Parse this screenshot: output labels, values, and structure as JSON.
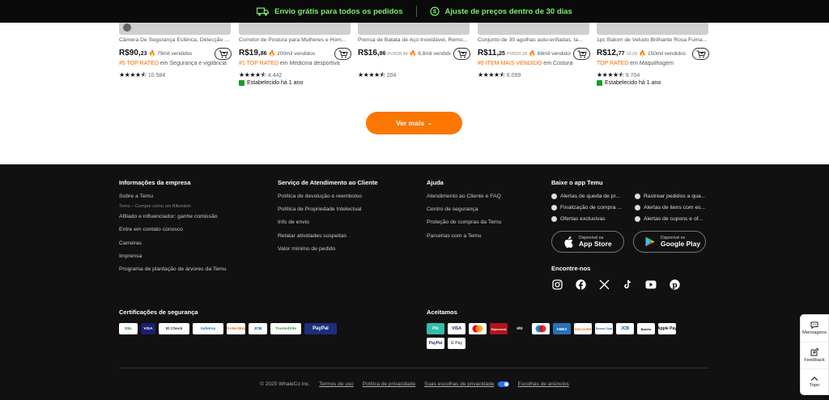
{
  "topbar": {
    "shipping": "Envio grátis para todos os pedidos",
    "price_adjust": "Ajuste de preços dentro de 30 dias"
  },
  "products": [
    {
      "title": "Câmera De Segurança Esférica, Detecção D...",
      "price_int": "R$90,",
      "price_dec": "23",
      "rrp": "",
      "sold": "79mil vendidos",
      "rank_hl": "#5 TOP RATED",
      "rank_rest": " em Segurança e vigilância",
      "rating_count": "10.584",
      "established": ""
    },
    {
      "title": "Corretor de Postura para Mulheres e Hom...",
      "price_int": "R$19,",
      "price_dec": "86",
      "rrp": "",
      "sold": "200mil vendidos",
      "rank_hl": "#1 TOP RATED",
      "rank_rest": " em Medicina desportiva",
      "rating_count": "4.442",
      "established": "Estabelecido há 1 ano"
    },
    {
      "title": "Prensa de Batata de Aço Inoxidável, Remo...",
      "price_int": "R$16,",
      "price_dec": "86",
      "rrp": "PVR28,44",
      "sold": "6,8mil vendidos",
      "rank_hl": "",
      "rank_rest": "",
      "rating_count": "204",
      "established": ""
    },
    {
      "title": "Conjunto de 30 agulhas auto-enfiadas, ta...",
      "price_int": "R$11,",
      "price_dec": "25",
      "rrp": "PVR20,18",
      "sold": "68mil vendidos",
      "rank_hl": "#6 ITEM MAIS VENDIDO",
      "rank_rest": " em Costura",
      "rating_count": "6.099",
      "established": ""
    },
    {
      "title": "1pc Batom de Veludo Brilhante Rosa Fuma...",
      "price_int": "R$12,",
      "price_dec": "77",
      "rrp": "19,99",
      "sold": "150mil vendidos",
      "rank_hl": "TOP RATED",
      "rank_rest": " em Maquilhagem",
      "rating_count": "9.704",
      "established": "Estabelecido há 1 ano"
    }
  ],
  "ver_mais": "Ver mais",
  "footer": {
    "company": {
      "heading": "Informações da empresa",
      "about": "Sobre a Temu",
      "tagline": "Temu – Compre como um Bilionário",
      "affiliate": "Afiliado e influenciador: ganhe comissão",
      "contact": "Entre em contato conosco",
      "careers": "Carreiras",
      "press": "Imprensa",
      "trees": "Programa de plantação de árvores da Temu"
    },
    "service": {
      "heading": "Serviço de Atendimento ao Cliente",
      "items": [
        "Política de devolução e reembolso",
        "Política de Propriedade Intelectual",
        "Info de envio",
        "Relatar atividades suspeitas",
        "Valor mínimo de pedido"
      ]
    },
    "help": {
      "heading": "Ajuda",
      "items": [
        "Atendimento ao Cliente e FAQ",
        "Centro de segurança",
        "Proteção de compras da Temu",
        "Parcerias com a Temu"
      ]
    },
    "app": {
      "heading": "Baixe o app Temu",
      "features": [
        "Alertas de queda de pr...",
        "Rastrear pedidos a qua...",
        "Finalização de compra ...",
        "Alertas de itens com es...",
        "Ofertas exclusivas",
        "Alertas de cupons e of..."
      ],
      "appstore_small": "Disponível na",
      "appstore": "App Store",
      "googleplay_small": "Disponível no",
      "googleplay": "Google Play"
    },
    "social_heading": "Encontre-nos",
    "security_heading": "Certificações de segurança",
    "security_badges": [
      "SSL",
      "VISA",
      "ID Check",
      "SafeKey",
      "ProtectBuy",
      "JCB",
      "TrustedSite",
      "PayPal"
    ],
    "accept_heading": "Aceitamos",
    "payments": [
      "Pix",
      "VISA",
      "Mastercard",
      "Hipercard",
      "elo",
      "Maestro",
      "AMEX",
      "DISCOVER",
      "Diners Club",
      "JCB",
      "Boleto",
      "Apple Pay",
      "PayPal",
      "G Pay"
    ],
    "legal": {
      "copyright": "© 2025 WhaleCo Inc.",
      "terms": "Termos de uso",
      "privacy": "Política de privacidade",
      "choices": "Suas escolhas de privacidade",
      "ads": "Escolhas de anúncios"
    }
  },
  "side": {
    "messages": "Mensagens",
    "feedback": "Feedback",
    "top": "Topo"
  }
}
